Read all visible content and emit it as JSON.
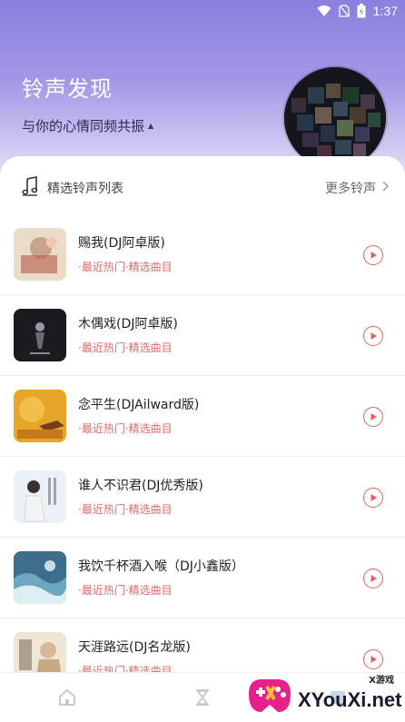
{
  "status_bar": {
    "time": "1:37"
  },
  "header": {
    "title": "铃声发现",
    "subtitle": "与你的心情同频共振"
  },
  "section": {
    "title": "精选铃声列表",
    "more_label": "更多铃声"
  },
  "songs": [
    {
      "title": "赐我(DJ阿卓版)",
      "tag": "·最近热门·精选曲目"
    },
    {
      "title": "木偶戏(DJ阿卓版)",
      "tag": "·最近热门·精选曲目"
    },
    {
      "title": "念平生(DJAilward版)",
      "tag": "·最近热门·精选曲目"
    },
    {
      "title": "谁人不识君(DJ优秀版)",
      "tag": "·最近热门·精选曲目"
    },
    {
      "title": "我饮千杯酒入喉（DJ小鑫版）",
      "tag": "·最近热门·精选曲目"
    },
    {
      "title": "天涯路远(DJ名龙版)",
      "tag": "·最近热门·精选曲目"
    }
  ],
  "bottom_nav": [
    {
      "icon": "home-icon"
    },
    {
      "icon": "hourglass-icon"
    },
    {
      "icon": "profile-icon"
    }
  ],
  "watermark": {
    "small": "X游戏",
    "text": "XYouXi.net"
  },
  "colors": {
    "accent": "#e2605f",
    "header_top": "#8b7fe0",
    "tag_text": "#e06a6a"
  }
}
